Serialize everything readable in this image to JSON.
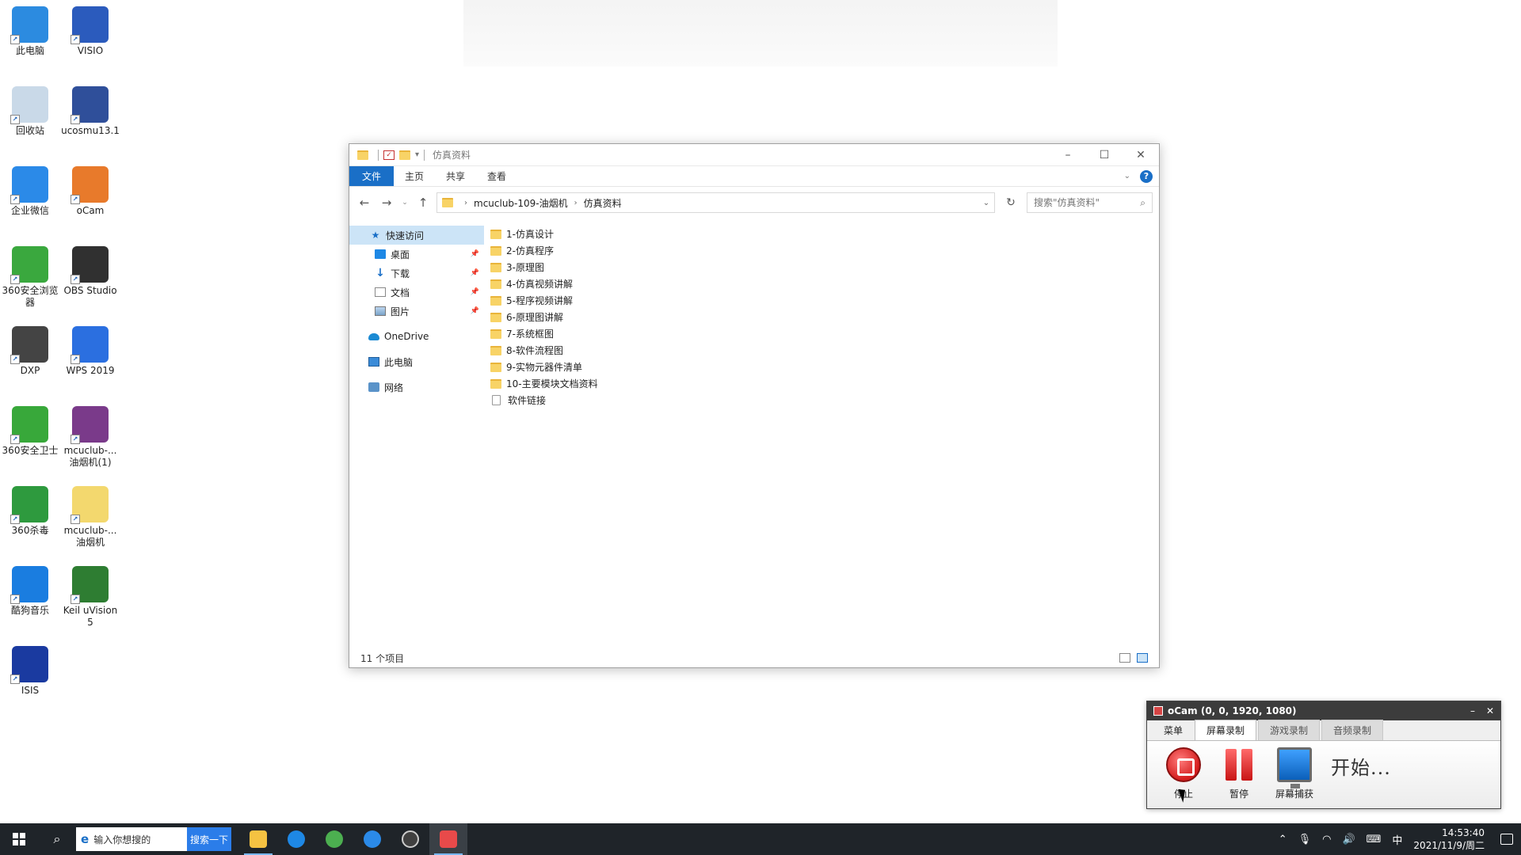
{
  "desktop": {
    "icons": [
      {
        "label": "此电脑",
        "color": "#2c8be0"
      },
      {
        "label": "VISIO",
        "color": "#2b5bbd"
      },
      {
        "label": "回收站",
        "color": "#c9d9e8"
      },
      {
        "label": "ucosmu13.1",
        "color": "#2f4f9a"
      },
      {
        "label": "企业微信",
        "color": "#2b8ae8"
      },
      {
        "label": "oCam",
        "color": "#e87a2b"
      },
      {
        "label": "360安全浏览器",
        "color": "#3aa83e"
      },
      {
        "label": "OBS Studio",
        "color": "#303030"
      },
      {
        "label": "DXP",
        "color": "#444444"
      },
      {
        "label": "WPS 2019",
        "color": "#2b6fe0"
      },
      {
        "label": "360安全卫士",
        "color": "#38a83a"
      },
      {
        "label": "mcuclub-...油烟机(1)",
        "color": "#7a3a8a"
      },
      {
        "label": "360杀毒",
        "color": "#2e9a3e"
      },
      {
        "label": "mcuclub-...油烟机",
        "color": "#f3d86e"
      },
      {
        "label": "酷狗音乐",
        "color": "#1a7de0"
      },
      {
        "label": "Keil uVision5",
        "color": "#2e7d32"
      },
      {
        "label": "ISIS",
        "color": "#1a3aa0"
      }
    ]
  },
  "explorer": {
    "title": "仿真资料",
    "ribbon_tabs": [
      "文件",
      "主页",
      "共享",
      "查看"
    ],
    "help": "?",
    "address": {
      "crumbs": [
        "mcuclub-109-油烟机",
        "仿真资料"
      ]
    },
    "search": {
      "placeholder": "搜索\"仿真资料\""
    },
    "nav": {
      "quick_access": "快速访问",
      "desktop": "桌面",
      "downloads": "下载",
      "documents": "文档",
      "pictures": "图片",
      "onedrive": "OneDrive",
      "this_pc": "此电脑",
      "network": "网络"
    },
    "files": [
      {
        "name": "1-仿真设计",
        "type": "folder"
      },
      {
        "name": "2-仿真程序",
        "type": "folder"
      },
      {
        "name": "3-原理图",
        "type": "folder"
      },
      {
        "name": "4-仿真视频讲解",
        "type": "folder"
      },
      {
        "name": "5-程序视频讲解",
        "type": "folder"
      },
      {
        "name": "6-原理图讲解",
        "type": "folder"
      },
      {
        "name": "7-系统框图",
        "type": "folder"
      },
      {
        "name": "8-软件流程图",
        "type": "folder"
      },
      {
        "name": "9-实物元器件清单",
        "type": "folder"
      },
      {
        "name": "10-主要模块文档资料",
        "type": "folder"
      },
      {
        "name": "软件链接",
        "type": "file"
      }
    ],
    "status": "11 个项目"
  },
  "ocam": {
    "title": "oCam (0, 0, 1920, 1080)",
    "tabs": [
      "菜单",
      "屏幕录制",
      "游戏录制",
      "音频录制"
    ],
    "buttons": {
      "stop": "停止",
      "pause": "暂停",
      "capture": "屏幕捕获"
    },
    "start_text": "开始..."
  },
  "taskbar": {
    "search_text": "输入你想搜的",
    "search_button": "搜索一下",
    "ime": "中",
    "time": "14:53:40",
    "date": "2021/11/9/周二"
  }
}
